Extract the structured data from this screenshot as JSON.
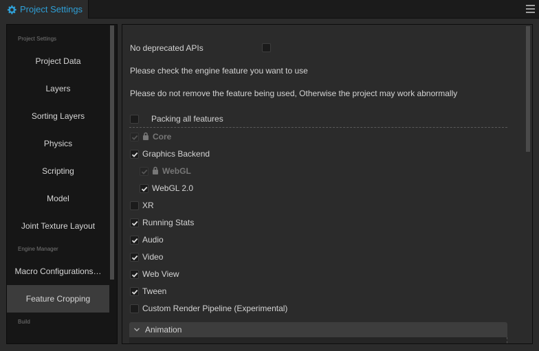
{
  "window": {
    "tab_title": "Project Settings",
    "tab_icon": "gear-icon",
    "menu_icon": "hamburger-menu-icon"
  },
  "sidebar": {
    "groups": [
      {
        "label": "Project Settings",
        "items": [
          {
            "label": "Project Data",
            "active": false
          },
          {
            "label": "Layers",
            "active": false
          },
          {
            "label": "Sorting Layers",
            "active": false
          },
          {
            "label": "Physics",
            "active": false
          },
          {
            "label": "Scripting",
            "active": false
          },
          {
            "label": "Model",
            "active": false
          },
          {
            "label": "Joint Texture Layout",
            "active": false
          }
        ]
      },
      {
        "label": "Engine Manager",
        "items": [
          {
            "label": "Macro Configurations…",
            "active": false
          },
          {
            "label": "Feature Cropping",
            "active": true
          }
        ]
      },
      {
        "label": "Build",
        "items": []
      }
    ]
  },
  "main": {
    "no_deprecated_label": "No deprecated APIs",
    "no_deprecated_checked": false,
    "info_line_1": "Please check the engine feature you want to use",
    "info_line_2": "Please do not remove the feature being used, Otherwise the project may work abnormally",
    "packing_all_label": "Packing all features",
    "packing_all_checked": false,
    "features": [
      {
        "label": "Core",
        "checked": true,
        "locked": true,
        "indent": 0
      },
      {
        "label": "Graphics Backend",
        "checked": true,
        "locked": false,
        "indent": 0
      },
      {
        "label": "WebGL",
        "checked": true,
        "locked": true,
        "indent": 1
      },
      {
        "label": "WebGL 2.0",
        "checked": true,
        "locked": false,
        "indent": 1
      },
      {
        "label": "XR",
        "checked": false,
        "locked": false,
        "indent": 0
      },
      {
        "label": "Running Stats",
        "checked": true,
        "locked": false,
        "indent": 0
      },
      {
        "label": "Audio",
        "checked": true,
        "locked": false,
        "indent": 0
      },
      {
        "label": "Video",
        "checked": true,
        "locked": false,
        "indent": 0
      },
      {
        "label": "Web View",
        "checked": true,
        "locked": false,
        "indent": 0
      },
      {
        "label": "Tween",
        "checked": true,
        "locked": false,
        "indent": 0
      },
      {
        "label": "Custom Render Pipeline (Experimental)",
        "checked": false,
        "locked": false,
        "indent": 0
      }
    ],
    "section": {
      "label": "Animation",
      "expanded": true
    }
  },
  "colors": {
    "accent": "#2f9fd6",
    "active_item_bg": "#3c3c3c"
  }
}
